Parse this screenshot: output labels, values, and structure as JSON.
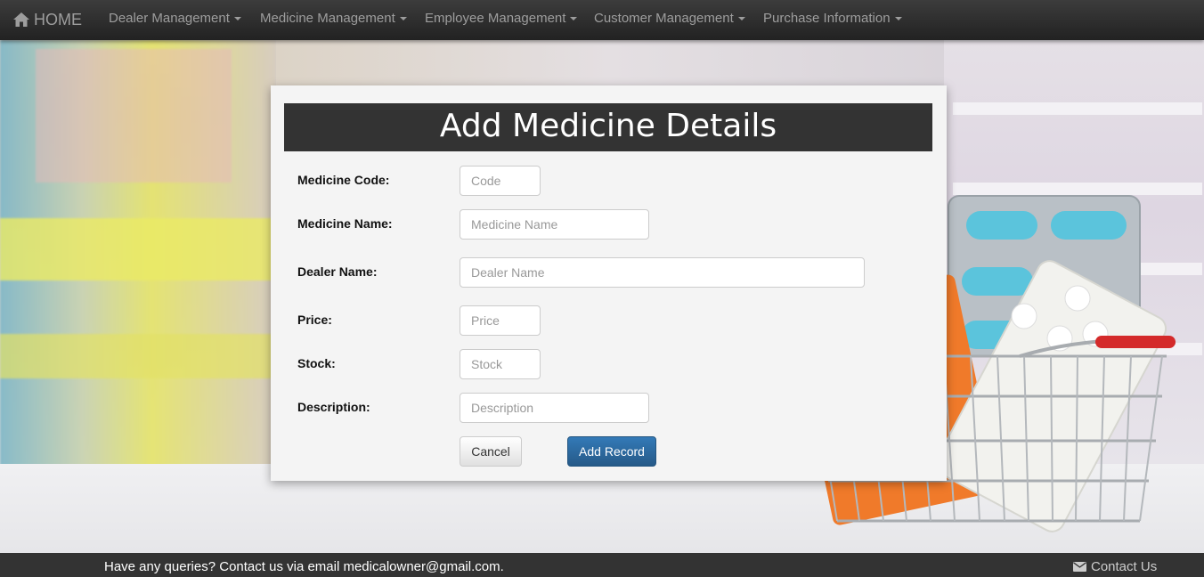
{
  "navbar": {
    "brand": "HOME",
    "items": [
      {
        "label": "Dealer Management"
      },
      {
        "label": "Medicine Management"
      },
      {
        "label": "Employee Management"
      },
      {
        "label": "Customer Management"
      },
      {
        "label": "Purchase Information"
      }
    ]
  },
  "form": {
    "title": "Add Medicine Details",
    "fields": [
      {
        "label": "Medicine Code:",
        "placeholder": "Code",
        "value": ""
      },
      {
        "label": "Medicine Name:",
        "placeholder": "Medicine Name",
        "value": ""
      },
      {
        "label": "Dealer Name:",
        "placeholder": "Dealer Name",
        "value": ""
      },
      {
        "label": "Price:",
        "placeholder": "Price",
        "value": ""
      },
      {
        "label": "Stock:",
        "placeholder": "Stock",
        "value": ""
      },
      {
        "label": "Description:",
        "placeholder": "Description",
        "value": ""
      }
    ],
    "cancel_label": "Cancel",
    "submit_label": "Add Record"
  },
  "footer": {
    "text": "Have any queries? Contact us via email medicalowner@gmail.com.",
    "contact_label": "Contact Us"
  },
  "colors": {
    "navbar": "#222222",
    "title_bar": "#333333",
    "primary_button": "#337ab7",
    "footer": "#333333"
  },
  "icons": [
    "home-icon",
    "caret-down-icon",
    "envelope-icon"
  ]
}
